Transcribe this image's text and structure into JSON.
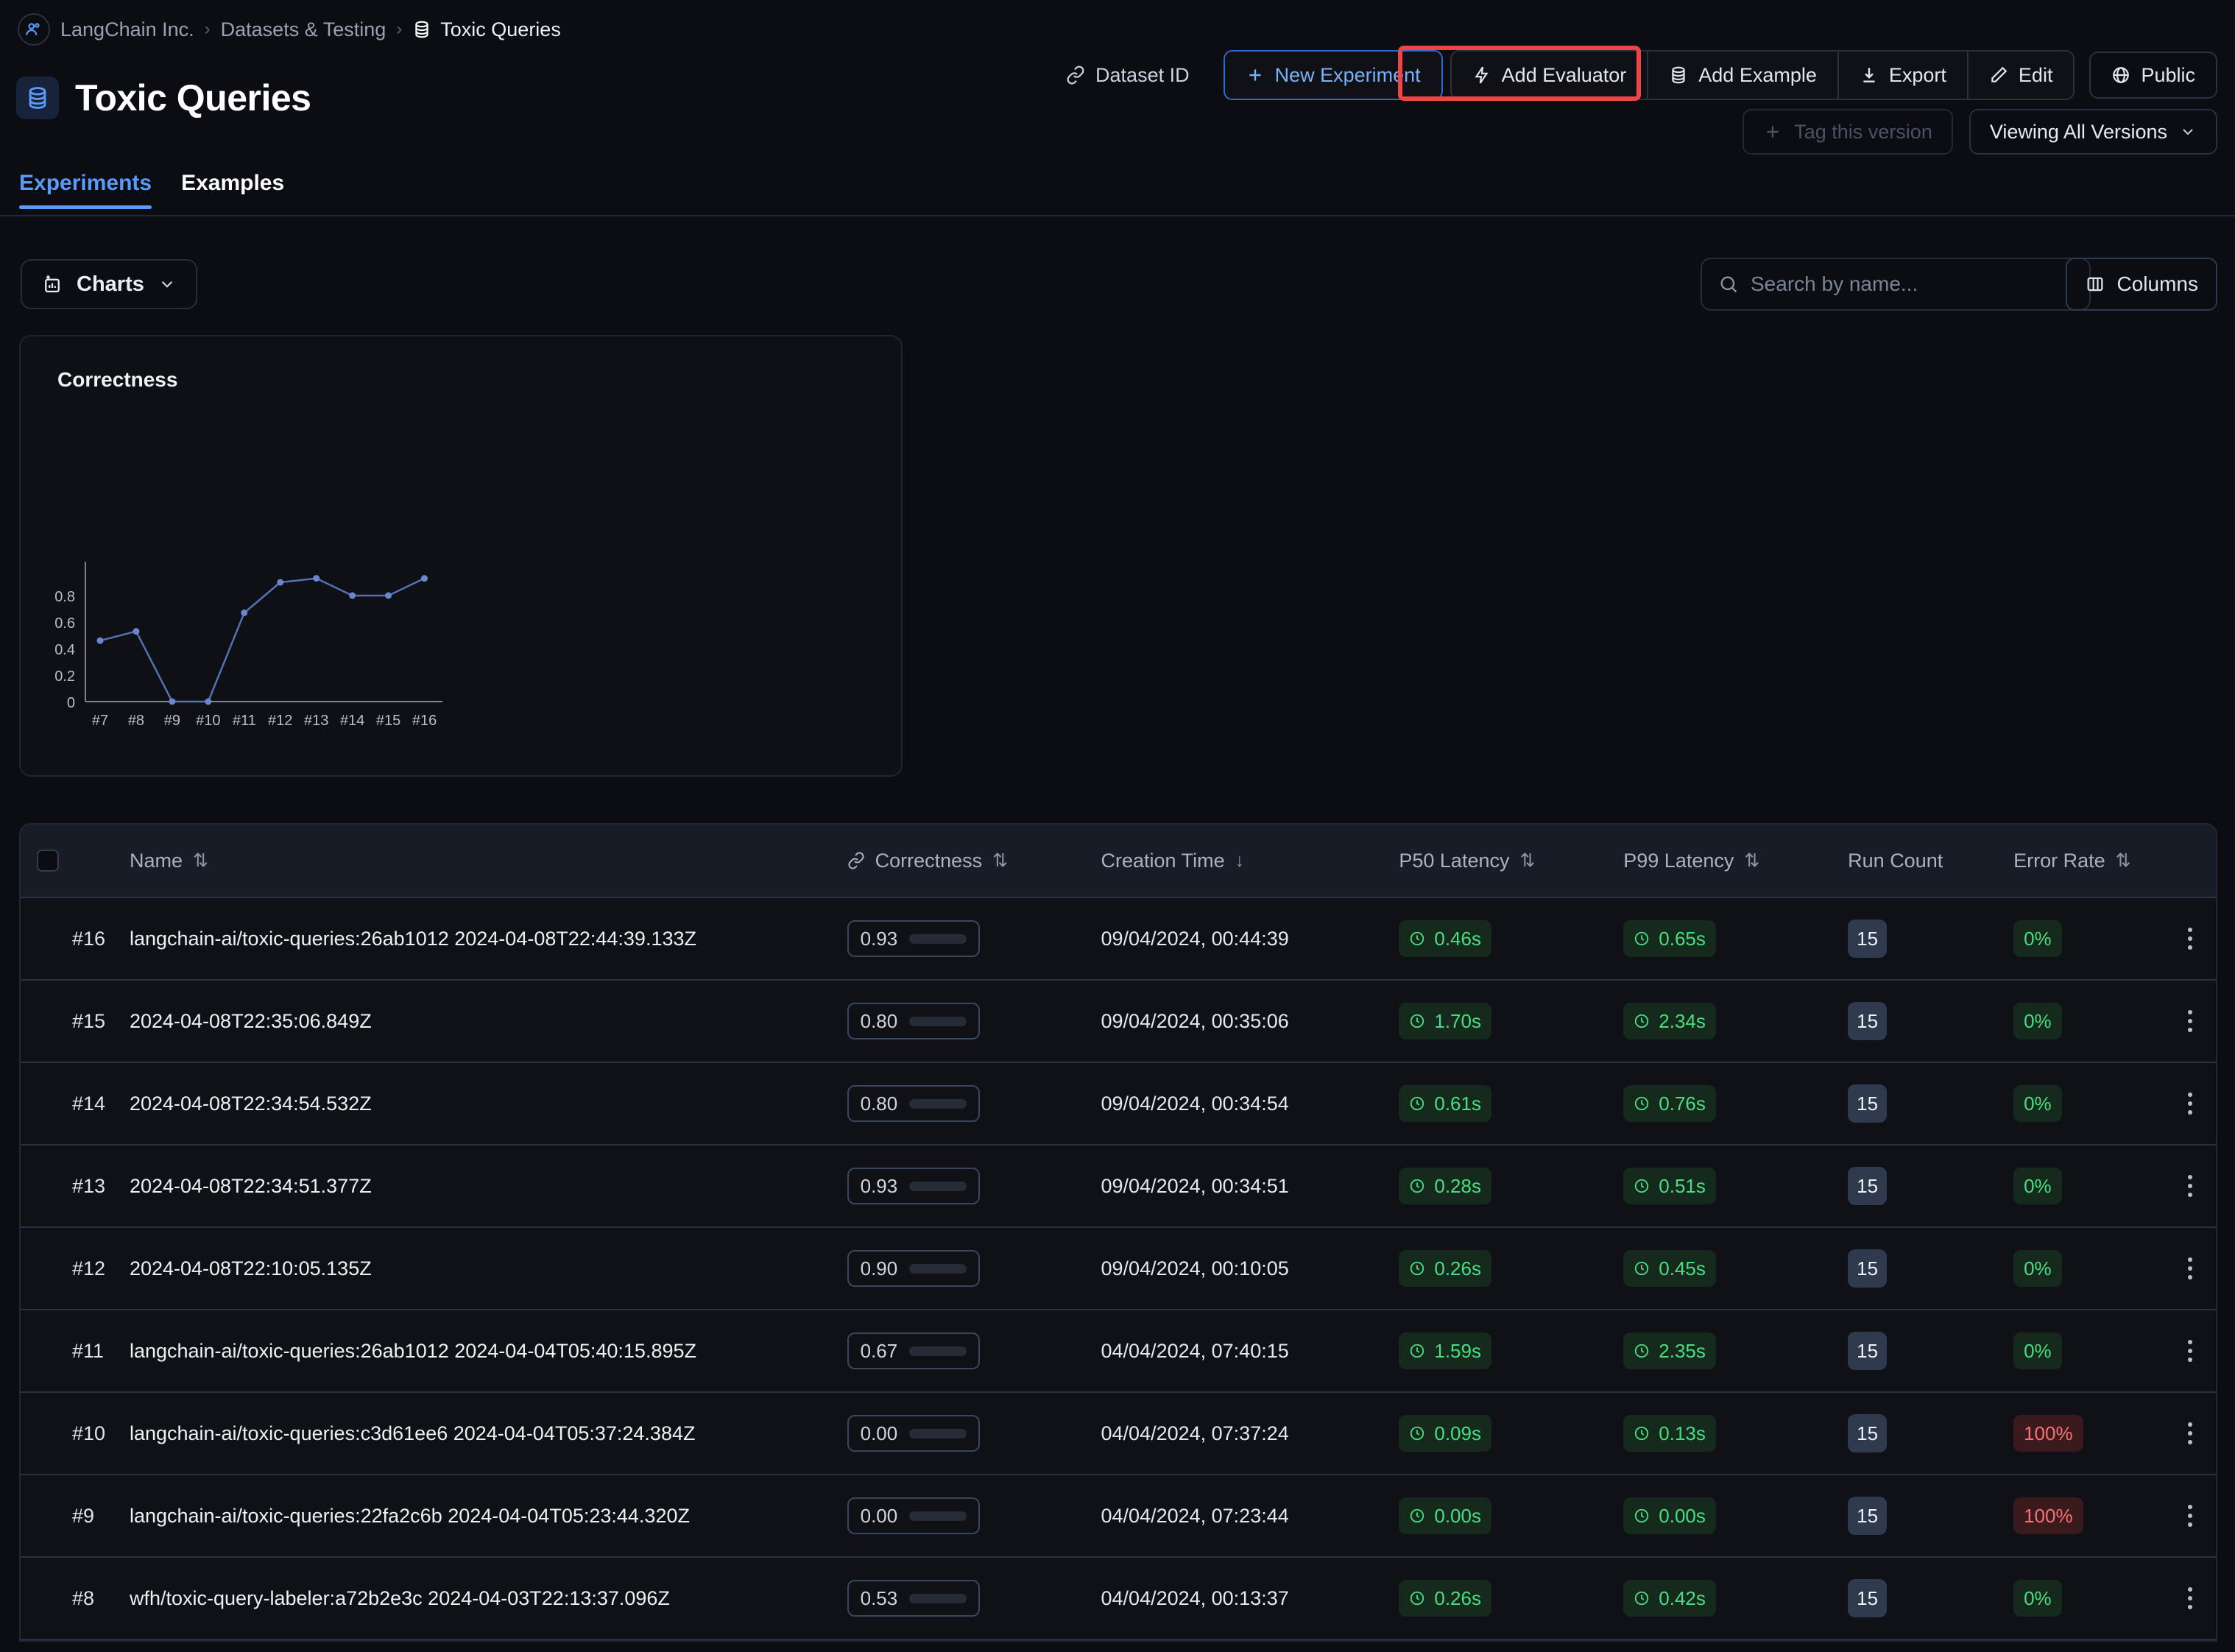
{
  "breadcrumb": {
    "org_icon": "org-avatar-icon",
    "org": "LangChain Inc.",
    "sep": "›",
    "section": "Datasets & Testing",
    "current": "Toxic Queries",
    "current_icon": "database-icon"
  },
  "header": {
    "title": "Toxic Queries",
    "title_icon": "database-icon"
  },
  "toolbar": {
    "dataset_id": "Dataset ID",
    "new_experiment": "New Experiment",
    "add_evaluator": "Add Evaluator",
    "add_example": "Add Example",
    "export": "Export",
    "edit": "Edit",
    "public": "Public",
    "highlight_color": "#ef4444",
    "accent_color": "#5b9bf8"
  },
  "version": {
    "tag_version": "Tag this version",
    "viewing": "Viewing All Versions"
  },
  "tabs": [
    {
      "label": "Experiments",
      "active": true
    },
    {
      "label": "Examples",
      "active": false
    }
  ],
  "controls": {
    "charts_label": "Charts",
    "search_placeholder": "Search by name...",
    "search_value": "",
    "columns_label": "Columns"
  },
  "chart_data": {
    "type": "line",
    "title": "Correctness",
    "xlabel": "",
    "ylabel": "",
    "categories": [
      "#7",
      "#8",
      "#9",
      "#10",
      "#11",
      "#12",
      "#13",
      "#14",
      "#15",
      "#16"
    ],
    "values": [
      0.46,
      0.53,
      0.0,
      0.0,
      0.67,
      0.9,
      0.93,
      0.8,
      0.8,
      0.93
    ],
    "yticks": [
      "0",
      "0.2",
      "0.4",
      "0.6",
      "0.8"
    ],
    "ytick_values": [
      0,
      0.2,
      0.4,
      0.6,
      0.8
    ],
    "ylim": [
      0,
      1.0
    ],
    "grid": false,
    "legend": "none",
    "line_color": "#5570b4",
    "marker_color": "#6b86cc"
  },
  "table": {
    "columns": [
      {
        "label": "Name",
        "sort": "both",
        "icon": null
      },
      {
        "label": "Correctness",
        "sort": "both",
        "icon": "link-icon"
      },
      {
        "label": "Creation Time",
        "sort": "desc",
        "icon": null
      },
      {
        "label": "P50 Latency",
        "sort": "both",
        "icon": null
      },
      {
        "label": "P99 Latency",
        "sort": "both",
        "icon": null
      },
      {
        "label": "Run Count",
        "sort": "none",
        "icon": null
      },
      {
        "label": "Error Rate",
        "sort": "both",
        "icon": null
      }
    ],
    "rows": [
      {
        "index": "#16",
        "name": "langchain-ai/toxic-queries:26ab1012 2024-04-08T22:44:39.133Z",
        "correctness": "0.93",
        "correctness_pct": 93,
        "creation_time": "09/04/2024, 00:44:39",
        "p50": "0.46s",
        "p99": "0.65s",
        "run_count": "15",
        "error_rate": "0%",
        "error_state": "ok"
      },
      {
        "index": "#15",
        "name": "2024-04-08T22:35:06.849Z",
        "correctness": "0.80",
        "correctness_pct": 80,
        "creation_time": "09/04/2024, 00:35:06",
        "p50": "1.70s",
        "p99": "2.34s",
        "run_count": "15",
        "error_rate": "0%",
        "error_state": "ok"
      },
      {
        "index": "#14",
        "name": "2024-04-08T22:34:54.532Z",
        "correctness": "0.80",
        "correctness_pct": 80,
        "creation_time": "09/04/2024, 00:34:54",
        "p50": "0.61s",
        "p99": "0.76s",
        "run_count": "15",
        "error_rate": "0%",
        "error_state": "ok"
      },
      {
        "index": "#13",
        "name": "2024-04-08T22:34:51.377Z",
        "correctness": "0.93",
        "correctness_pct": 93,
        "creation_time": "09/04/2024, 00:34:51",
        "p50": "0.28s",
        "p99": "0.51s",
        "run_count": "15",
        "error_rate": "0%",
        "error_state": "ok"
      },
      {
        "index": "#12",
        "name": "2024-04-08T22:10:05.135Z",
        "correctness": "0.90",
        "correctness_pct": 90,
        "creation_time": "09/04/2024, 00:10:05",
        "p50": "0.26s",
        "p99": "0.45s",
        "run_count": "15",
        "error_rate": "0%",
        "error_state": "ok"
      },
      {
        "index": "#11",
        "name": "langchain-ai/toxic-queries:26ab1012 2024-04-04T05:40:15.895Z",
        "correctness": "0.67",
        "correctness_pct": 67,
        "creation_time": "04/04/2024, 07:40:15",
        "p50": "1.59s",
        "p99": "2.35s",
        "run_count": "15",
        "error_rate": "0%",
        "error_state": "ok"
      },
      {
        "index": "#10",
        "name": "langchain-ai/toxic-queries:c3d61ee6 2024-04-04T05:37:24.384Z",
        "correctness": "0.00",
        "correctness_pct": 0,
        "creation_time": "04/04/2024, 07:37:24",
        "p50": "0.09s",
        "p99": "0.13s",
        "run_count": "15",
        "error_rate": "100%",
        "error_state": "bad"
      },
      {
        "index": "#9",
        "name": "langchain-ai/toxic-queries:22fa2c6b 2024-04-04T05:23:44.320Z",
        "correctness": "0.00",
        "correctness_pct": 0,
        "creation_time": "04/04/2024, 07:23:44",
        "p50": "0.00s",
        "p99": "0.00s",
        "run_count": "15",
        "error_rate": "100%",
        "error_state": "bad"
      },
      {
        "index": "#8",
        "name": "wfh/toxic-query-labeler:a72b2e3c 2024-04-03T22:13:37.096Z",
        "correctness": "0.53",
        "correctness_pct": 53,
        "creation_time": "04/04/2024, 00:13:37",
        "p50": "0.26s",
        "p99": "0.42s",
        "run_count": "15",
        "error_rate": "0%",
        "error_state": "ok"
      }
    ]
  }
}
